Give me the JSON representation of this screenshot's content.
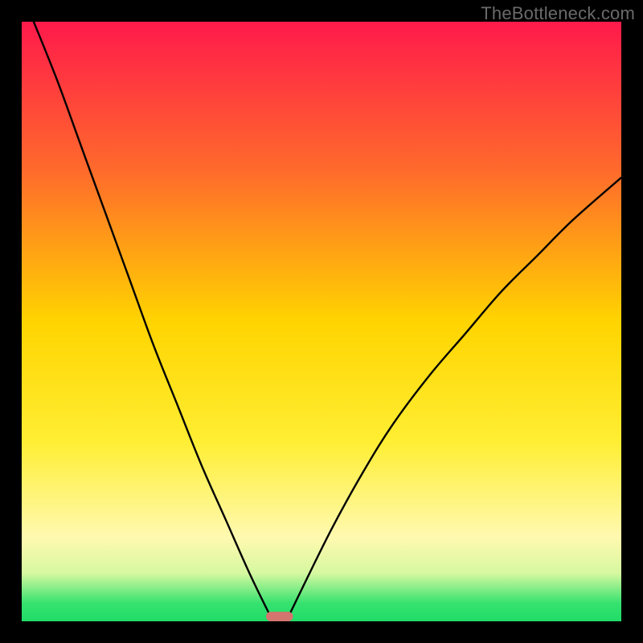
{
  "watermark": "TheBottleneck.com",
  "chart_data": {
    "type": "line",
    "title": "",
    "xlabel": "",
    "ylabel": "",
    "xlim": [
      0,
      100
    ],
    "ylim": [
      0,
      100
    ],
    "grid": false,
    "legend": false,
    "annotations": [],
    "background_gradient_stops": [
      {
        "offset": 0.0,
        "color": "#ff1a4b"
      },
      {
        "offset": 0.25,
        "color": "#ff6b2b"
      },
      {
        "offset": 0.5,
        "color": "#ffd400"
      },
      {
        "offset": 0.7,
        "color": "#ffee33"
      },
      {
        "offset": 0.86,
        "color": "#fff9b0"
      },
      {
        "offset": 0.92,
        "color": "#d6f8a0"
      },
      {
        "offset": 0.97,
        "color": "#36e26f"
      },
      {
        "offset": 1.0,
        "color": "#20dc68"
      }
    ],
    "series": [
      {
        "name": "left-curve",
        "x": [
          2,
          6,
          10,
          14,
          18,
          22,
          26,
          30,
          34,
          38,
          41.5
        ],
        "y": [
          100,
          90,
          79,
          68,
          57,
          46,
          36,
          26,
          17,
          8,
          0.8
        ]
      },
      {
        "name": "right-curve",
        "x": [
          44.5,
          48,
          52,
          57,
          62,
          68,
          74,
          80,
          86,
          92,
          100
        ],
        "y": [
          0.8,
          8,
          16,
          25,
          33,
          41,
          48,
          55,
          61,
          67,
          74
        ]
      }
    ],
    "marker": {
      "name": "min-marker",
      "x_center": 43,
      "y_center": 0.8,
      "width": 4.5,
      "height": 1.6,
      "color": "#d4746f"
    }
  }
}
